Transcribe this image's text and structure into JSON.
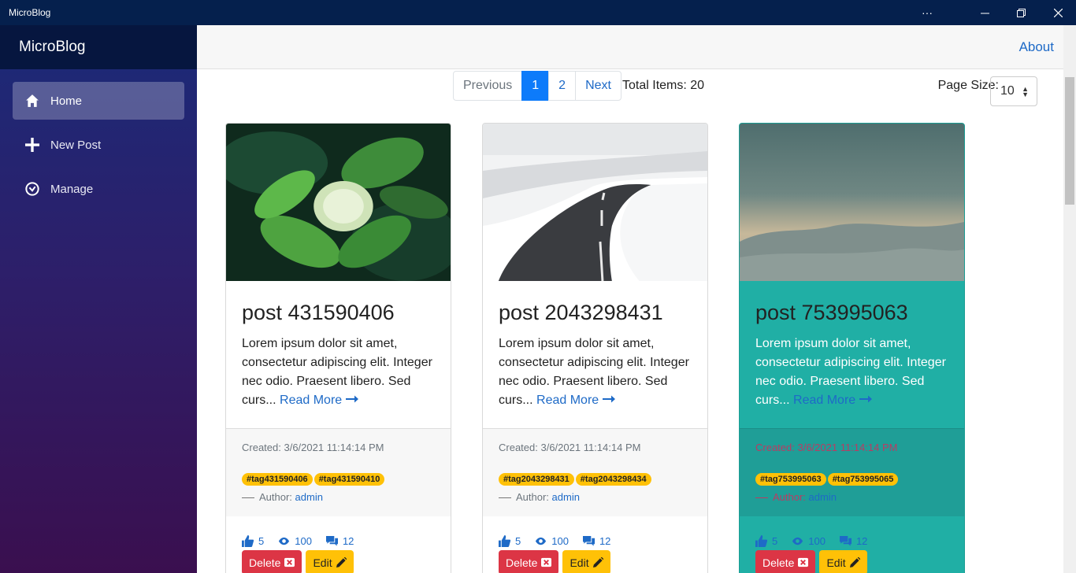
{
  "window": {
    "title": "MicroBlog",
    "more": "···",
    "minimize": "—",
    "restore": "❐",
    "close": "✕"
  },
  "sidebar": {
    "brand": "MicroBlog",
    "items": [
      {
        "label": "Home",
        "icon": "home-icon",
        "active": true
      },
      {
        "label": "New Post",
        "icon": "plus-icon",
        "active": false
      },
      {
        "label": "Manage",
        "icon": "manage-icon",
        "active": false
      }
    ]
  },
  "topbar": {
    "about": "About"
  },
  "pagination": {
    "previous": "Previous",
    "pages": [
      "1",
      "2"
    ],
    "next": "Next",
    "total": "Total Items: 20",
    "page_size_label": "Page Size:",
    "page_size": "10"
  },
  "cards": [
    {
      "title": "post 431590406",
      "excerpt": "Lorem ipsum dolor sit amet, consectetur adipiscing elit. Integer nec odio. Praesent libero. Sed curs...",
      "read_more": "Read More",
      "created": "Created: 3/6/2021 11:14:14 PM",
      "tags": [
        "#tag431590406",
        "#tag431590410"
      ],
      "author_label": "Author:",
      "author": "admin",
      "likes": "5",
      "views": "100",
      "comments": "12",
      "delete": "Delete",
      "edit": "Edit"
    },
    {
      "title": "post 2043298431",
      "excerpt": "Lorem ipsum dolor sit amet, consectetur adipiscing elit. Integer nec odio. Praesent libero. Sed curs...",
      "read_more": "Read More",
      "created": "Created: 3/6/2021 11:14:14 PM",
      "tags": [
        "#tag2043298431",
        "#tag2043298434"
      ],
      "author_label": "Author:",
      "author": "admin",
      "likes": "5",
      "views": "100",
      "comments": "12",
      "delete": "Delete",
      "edit": "Edit"
    },
    {
      "title": "post 753995063",
      "excerpt": "Lorem ipsum dolor sit amet, consectetur adipiscing elit. Integer nec odio. Praesent libero. Sed curs...",
      "read_more": "Read More",
      "created": "Created: 3/6/2021 11:14:14 PM",
      "tags": [
        "#tag753995063",
        "#tag753995065"
      ],
      "author_label": "Author:",
      "author": "admin",
      "likes": "5",
      "views": "100",
      "comments": "12",
      "delete": "Delete",
      "edit": "Edit"
    }
  ],
  "colors": {
    "sidebar_top": "#1b2a78",
    "sidebar_bottom": "#3a0f4f",
    "active_page": "#0d7bfa",
    "highlight_card": "#20afa5",
    "tag": "#ffc107",
    "delete": "#dc3545"
  }
}
